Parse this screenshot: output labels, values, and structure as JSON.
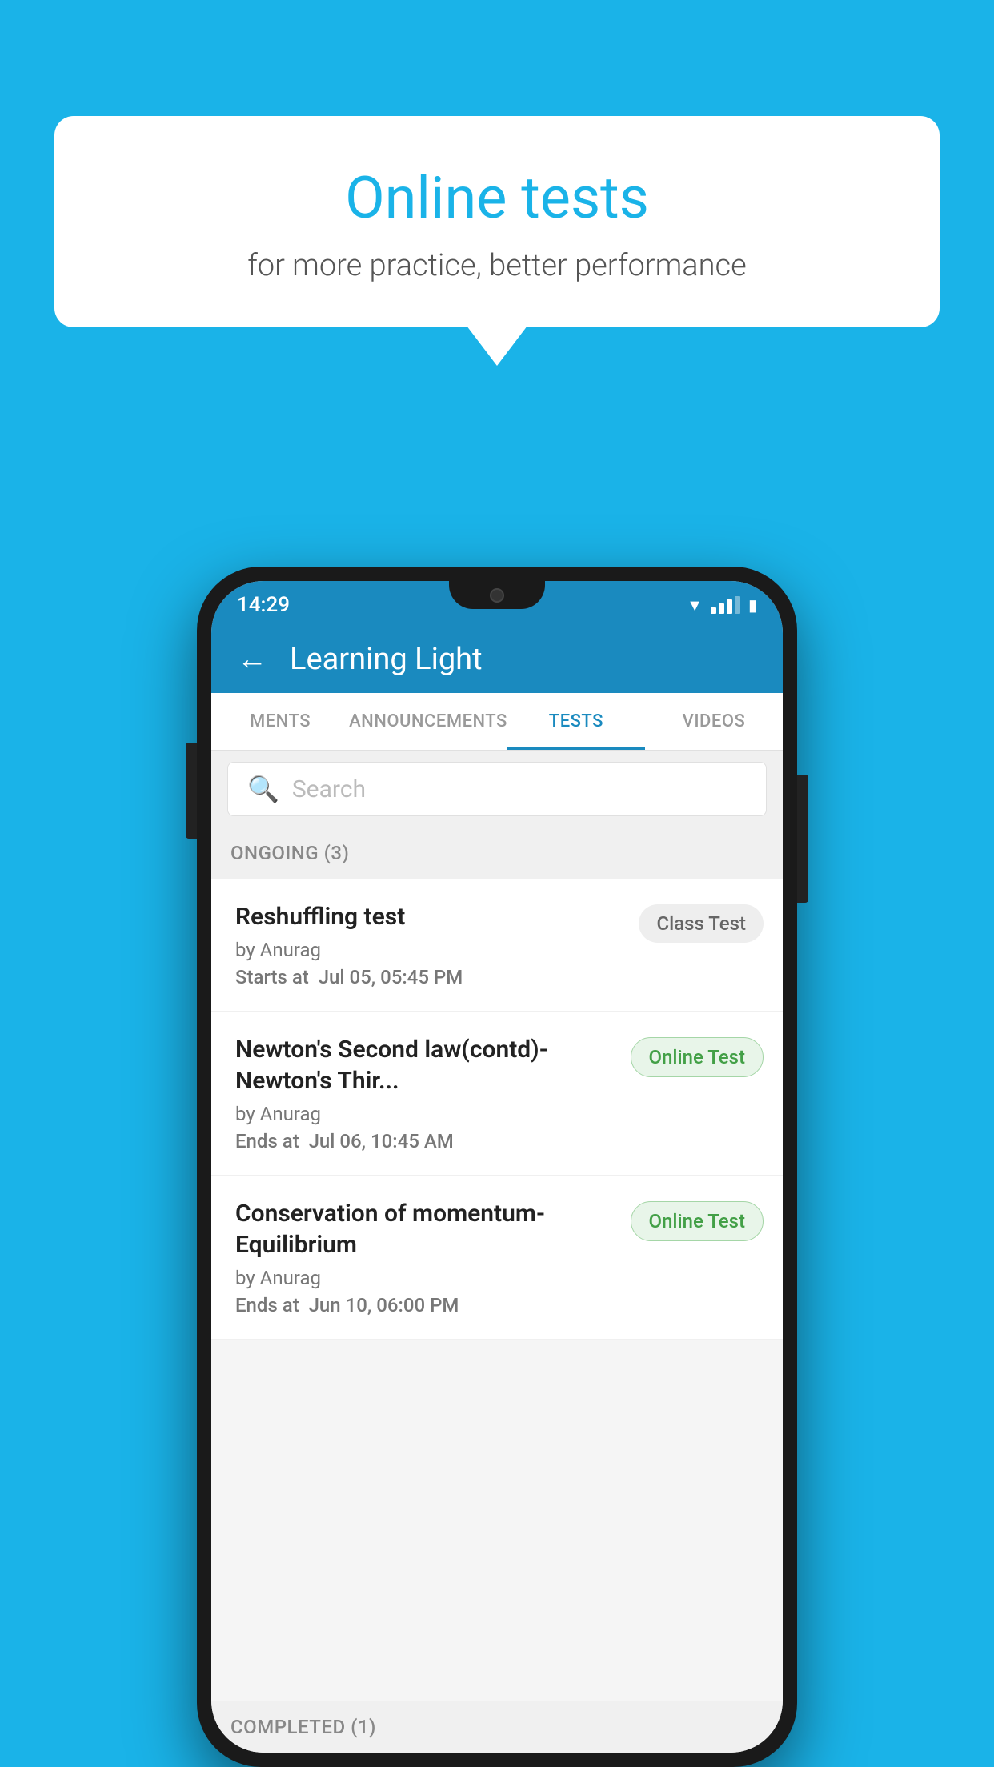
{
  "background": {
    "color": "#1ab3e8"
  },
  "speech_bubble": {
    "title": "Online tests",
    "subtitle": "for more practice, better performance"
  },
  "phone": {
    "status_bar": {
      "time": "14:29",
      "wifi": "▼",
      "battery": "▮"
    },
    "app_bar": {
      "title": "Learning Light",
      "back_label": "←"
    },
    "tabs": [
      {
        "label": "MENTS",
        "active": false
      },
      {
        "label": "ANNOUNCEMENTS",
        "active": false
      },
      {
        "label": "TESTS",
        "active": true
      },
      {
        "label": "VIDEOS",
        "active": false
      }
    ],
    "search": {
      "placeholder": "Search"
    },
    "ongoing_section": {
      "label": "ONGOING (3)"
    },
    "tests": [
      {
        "title": "Reshuffling test",
        "author": "by Anurag",
        "time_label": "Starts at",
        "time": "Jul 05, 05:45 PM",
        "badge": "Class Test",
        "badge_type": "class"
      },
      {
        "title": "Newton's Second law(contd)-Newton's Thir...",
        "author": "by Anurag",
        "time_label": "Ends at",
        "time": "Jul 06, 10:45 AM",
        "badge": "Online Test",
        "badge_type": "online"
      },
      {
        "title": "Conservation of momentum-Equilibrium",
        "author": "by Anurag",
        "time_label": "Ends at",
        "time": "Jun 10, 06:00 PM",
        "badge": "Online Test",
        "badge_type": "online"
      }
    ],
    "completed_section": {
      "label": "COMPLETED (1)"
    }
  }
}
